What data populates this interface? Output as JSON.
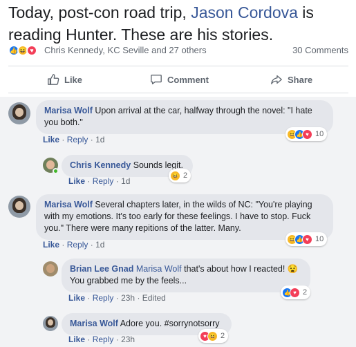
{
  "post": {
    "text_before": "Today, post-con road trip, ",
    "mention": "Jason Cordova",
    "text_after": " is reading Hunter. These are his stories."
  },
  "reactions": {
    "names": "Chris Kennedy, KC Seville and 27 others",
    "comments_count": "30 Comments"
  },
  "actions": {
    "like": "Like",
    "comment": "Comment",
    "share": "Share"
  },
  "comments": [
    {
      "author": "Marisa Wolf",
      "text": "Upon arrival at the car, halfway through the novel: \"I hate you both.\"",
      "like": "Like",
      "reply": "Reply",
      "time": "1d",
      "reaction_count": "10"
    },
    {
      "author": "Chris Kennedy",
      "text": "Sounds legit.",
      "like": "Like",
      "reply": "Reply",
      "time": "1d",
      "reaction_count": "2"
    },
    {
      "author": "Marisa Wolf",
      "text": "Several chapters later, in the wilds of NC: \"You're playing with my emotions. It's too early for these feelings. I have to stop. Fuck you.\" There were many repitions of the latter. Many.",
      "like": "Like",
      "reply": "Reply",
      "time": "1d",
      "reaction_count": "10"
    },
    {
      "author": "Brian Lee Gnad",
      "mention": "Marisa Wolf",
      "text": "that's about how I reacted! 😧 You grabbed me by the feels...",
      "like": "Like",
      "reply": "Reply",
      "time": "23h",
      "edited": "Edited",
      "reaction_count": "2"
    },
    {
      "author": "Marisa Wolf",
      "text": "Adore you. #sorrynotsorry",
      "like": "Like",
      "reply": "Reply",
      "time": "23h",
      "reaction_count": "2"
    }
  ],
  "colors": {
    "link": "#385898",
    "like_blue": "#1877f2",
    "haha_yellow": "#f7b928",
    "love_red": "#f33e58",
    "bubble_bg": "#e4e6eb",
    "comments_bg": "#f2f3f5"
  },
  "icons": {
    "like_action": "thumbs-up-icon",
    "comment_action": "speech-bubble-icon",
    "share_action": "share-arrow-icon"
  },
  "separator": "·"
}
